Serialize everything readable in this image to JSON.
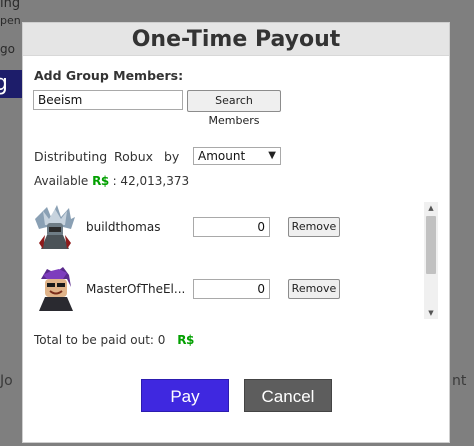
{
  "background": {
    "fragment_top": "ing",
    "fragment_top2": "pen",
    "fragment_mid": "go",
    "fragment_tab": "g",
    "fragment_left": "Jo",
    "fragment_right": "nt"
  },
  "modal": {
    "title": "One-Time Payout",
    "add_label": "Add Group Members:",
    "search": {
      "value": "Beeism",
      "button_label": "Search Members"
    },
    "distributing": {
      "word1": "Distributing",
      "currency": "Robux",
      "word2": "by",
      "selected": "Amount",
      "options": [
        "Amount"
      ]
    },
    "available": {
      "label": "Available",
      "currency_symbol": "R$",
      "value": ": 42,013,373"
    },
    "members": [
      {
        "name": "buildthomas",
        "amount": "0",
        "remove_label": "Remove"
      },
      {
        "name": "MasterOfTheEl...",
        "amount": "0",
        "remove_label": "Remove"
      }
    ],
    "total": {
      "label": "Total to be paid out: 0",
      "currency_symbol": "R$"
    },
    "pay_label": "Pay",
    "cancel_label": "Cancel"
  },
  "colors": {
    "pay": "#3f28e0",
    "cancel": "#5d5d5d",
    "robux": "#02a000"
  },
  "icons": [
    "robux-icon",
    "chevron-down-icon",
    "scroll-up-icon",
    "scroll-down-icon"
  ]
}
